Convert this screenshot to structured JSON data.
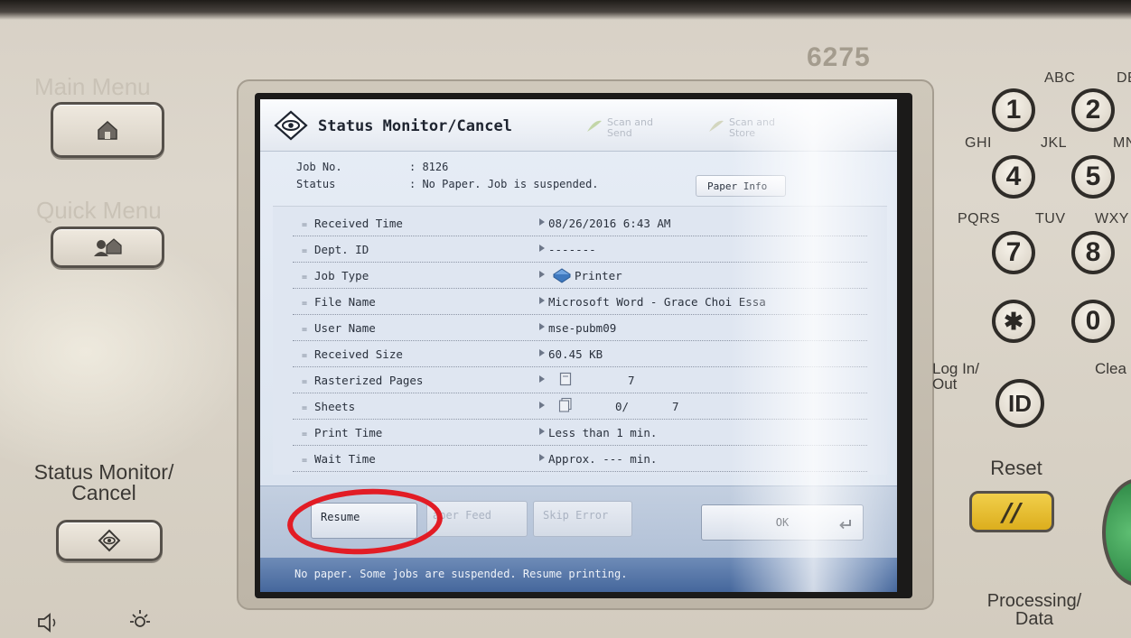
{
  "device": {
    "model": "6275",
    "left_labels": {
      "main_menu": "Main Menu",
      "quick_menu": "Quick Menu",
      "status_monitor": "Status Monitor/ Cancel"
    },
    "keypad": [
      {
        "key": "1",
        "sub": ""
      },
      {
        "key": "2",
        "sub": "ABC"
      },
      {
        "key": "4",
        "sub": "GHI"
      },
      {
        "key": "5",
        "sub": "JKL"
      },
      {
        "key": "7",
        "sub": "PQRS"
      },
      {
        "key": "8",
        "sub": "TUV"
      },
      {
        "key": "✱",
        "sub": ""
      },
      {
        "key": "0",
        "sub": ""
      },
      {
        "key": "ID",
        "sub": ""
      }
    ],
    "keypad_partial_labels": {
      "def": "DE",
      "mno": "MN",
      "wxyz": "WXY"
    },
    "login_label": "Log In/ Out",
    "clear_label": "Clea",
    "reset_label": "Reset",
    "reset_symbol": "//",
    "processing_label": "Processing/ Data"
  },
  "screen": {
    "title": "Status Monitor/Cancel",
    "tabs": [
      {
        "label": "Scan and Send"
      },
      {
        "label": "Scan and Store"
      }
    ],
    "job_no_label": "Job No.",
    "job_no": ": 8126",
    "status_label": "Status",
    "status_value": ": No Paper. Job is suspended.",
    "paper_info_label": "Paper Info",
    "rows": [
      {
        "label": "Received Time",
        "value": "08/26/2016 6:43 AM"
      },
      {
        "label": "Dept. ID",
        "value": "-------"
      },
      {
        "label": "Job Type",
        "value": "Printer",
        "icon": "printer-icon"
      },
      {
        "label": "File Name",
        "value": "Microsoft Word - Grace Choi Essa"
      },
      {
        "label": "User Name",
        "value": "mse-pubm09"
      },
      {
        "label": "Received Size",
        "value": "60.45 KB"
      },
      {
        "label": "Rasterized Pages",
        "value": "7",
        "icon": "page-icon"
      },
      {
        "label": "Sheets",
        "value": "0/",
        "value2": "7",
        "icon": "sheets-icon"
      },
      {
        "label": "Print Time",
        "value": "Less than 1 min."
      },
      {
        "label": "Wait Time",
        "value": "Approx. ---  min."
      }
    ],
    "buttons": {
      "resume": "Resume",
      "paper_feed": "aper Feed",
      "skip_error": "Skip Error",
      "ok": "OK"
    },
    "status_message": "No paper. Some jobs are suspended. Resume printing."
  },
  "colors": {
    "highlight_circle": "#e21c25",
    "status_bar": "#45679c",
    "reset_button": "#dcae1d"
  }
}
